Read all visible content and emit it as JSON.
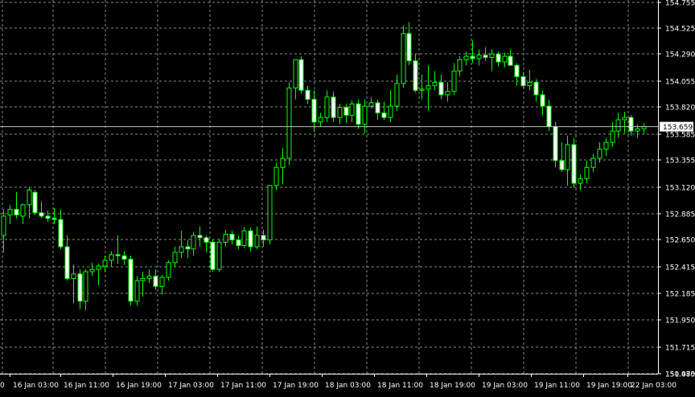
{
  "colors": {
    "background": "#000000",
    "grid": "#8a8a8a",
    "axis": "#ffffff",
    "bull_body": "#000000",
    "bull_outline": "#00ff00",
    "bear_body": "#ffffff",
    "bear_outline": "#00ff00",
    "bid_line": "#c0c0c0",
    "bid_label_bg": "#ffffff"
  },
  "chart_data": {
    "type": "candlestick",
    "grid": true,
    "ylim": [
      150.075,
      154.75
    ],
    "y_ticks": [
      "154.755",
      "154.525",
      "154.290",
      "154.055",
      "153.820",
      "153.585",
      "153.355",
      "153.120",
      "152.885",
      "152.650",
      "152.415",
      "152.185",
      "151.950",
      "151.715",
      "151.480",
      "150.075"
    ],
    "x_ticks": [
      "0",
      "16 Jan 03:00",
      "16 Jan 11:00",
      "16 Jan 19:00",
      "17 Jan 03:00",
      "17 Jan 11:00",
      "17 Jan 19:00",
      "18 Jan 03:00",
      "18 Jan 11:00",
      "18 Jan 19:00",
      "19 Jan 03:00",
      "19 Jan 11:00",
      "19 Jan 19:00",
      "22 Jan 03:00"
    ],
    "bid": "153.659",
    "ohlc": [
      [
        152.7,
        152.93,
        152.55,
        152.87
      ],
      [
        152.88,
        152.97,
        152.8,
        152.93
      ],
      [
        152.93,
        153.08,
        152.85,
        152.88
      ],
      [
        152.87,
        152.98,
        152.8,
        152.97
      ],
      [
        152.97,
        153.12,
        152.85,
        153.1
      ],
      [
        153.08,
        153.1,
        152.88,
        152.9
      ],
      [
        152.9,
        153.0,
        152.85,
        152.87
      ],
      [
        152.87,
        152.92,
        152.82,
        152.85
      ],
      [
        152.85,
        152.94,
        152.8,
        152.84
      ],
      [
        152.84,
        152.93,
        152.58,
        152.6
      ],
      [
        152.6,
        152.7,
        152.3,
        152.32
      ],
      [
        152.32,
        152.44,
        152.1,
        152.36
      ],
      [
        152.36,
        152.4,
        152.05,
        152.12
      ],
      [
        152.12,
        152.4,
        152.04,
        152.38
      ],
      [
        152.38,
        152.46,
        152.34,
        152.4
      ],
      [
        152.4,
        152.45,
        152.26,
        152.43
      ],
      [
        152.43,
        152.52,
        152.38,
        152.48
      ],
      [
        152.48,
        152.56,
        152.42,
        152.53
      ],
      [
        152.53,
        152.7,
        152.45,
        152.52
      ],
      [
        152.52,
        152.56,
        152.44,
        152.49
      ],
      [
        152.49,
        152.52,
        152.08,
        152.12
      ],
      [
        152.12,
        152.34,
        152.08,
        152.3
      ],
      [
        152.3,
        152.38,
        152.16,
        152.32
      ],
      [
        152.32,
        152.4,
        152.28,
        152.34
      ],
      [
        152.34,
        152.4,
        152.22,
        152.25
      ],
      [
        152.25,
        152.35,
        152.18,
        152.33
      ],
      [
        152.33,
        152.48,
        152.3,
        152.46
      ],
      [
        152.46,
        152.6,
        152.42,
        152.55
      ],
      [
        152.55,
        152.74,
        152.5,
        152.6
      ],
      [
        152.6,
        152.66,
        152.5,
        152.58
      ],
      [
        152.58,
        152.73,
        152.52,
        152.7
      ],
      [
        152.7,
        152.78,
        152.6,
        152.68
      ],
      [
        152.68,
        152.7,
        152.55,
        152.64
      ],
      [
        152.64,
        152.66,
        152.38,
        152.4
      ],
      [
        152.4,
        152.67,
        152.38,
        152.64
      ],
      [
        152.64,
        152.75,
        152.6,
        152.71
      ],
      [
        152.71,
        152.74,
        152.62,
        152.66
      ],
      [
        152.66,
        152.7,
        152.58,
        152.61
      ],
      [
        152.61,
        152.77,
        152.59,
        152.74
      ],
      [
        152.74,
        152.77,
        152.56,
        152.6
      ],
      [
        152.6,
        152.78,
        152.58,
        152.7
      ],
      [
        152.7,
        152.75,
        152.6,
        152.66
      ],
      [
        152.66,
        152.98,
        152.62,
        153.14
      ],
      [
        153.14,
        153.34,
        153.1,
        153.3
      ],
      [
        153.3,
        153.47,
        153.15,
        153.38
      ],
      [
        153.38,
        154.05,
        153.32,
        154.0
      ],
      [
        154.0,
        154.22,
        153.9,
        154.25
      ],
      [
        154.25,
        154.28,
        153.95,
        153.98
      ],
      [
        153.98,
        154.02,
        153.86,
        153.9
      ],
      [
        153.9,
        153.98,
        153.62,
        153.7
      ],
      [
        153.7,
        153.78,
        153.66,
        153.74
      ],
      [
        153.74,
        153.98,
        153.7,
        153.92
      ],
      [
        153.92,
        153.97,
        153.7,
        153.74
      ],
      [
        153.74,
        153.86,
        153.68,
        153.83
      ],
      [
        153.83,
        153.86,
        153.69,
        153.76
      ],
      [
        153.76,
        153.89,
        153.7,
        153.86
      ],
      [
        153.86,
        153.9,
        153.64,
        153.68
      ],
      [
        153.68,
        153.9,
        153.6,
        153.84
      ],
      [
        153.84,
        153.92,
        153.82,
        153.87
      ],
      [
        153.87,
        153.9,
        153.72,
        153.78
      ],
      [
        153.78,
        153.88,
        153.72,
        153.74
      ],
      [
        153.74,
        153.98,
        153.7,
        153.84
      ],
      [
        153.84,
        154.12,
        153.8,
        154.04
      ],
      [
        154.04,
        154.55,
        154.0,
        154.48
      ],
      [
        154.48,
        154.58,
        154.2,
        154.24
      ],
      [
        154.24,
        154.3,
        153.96,
        153.98
      ],
      [
        153.98,
        154.12,
        153.9,
        153.99
      ],
      [
        153.99,
        154.2,
        153.8,
        154.02
      ],
      [
        154.02,
        154.15,
        153.98,
        154.05
      ],
      [
        154.05,
        154.12,
        153.9,
        153.94
      ],
      [
        153.94,
        154.05,
        153.88,
        153.97
      ],
      [
        153.97,
        154.22,
        153.94,
        154.15
      ],
      [
        154.15,
        154.28,
        154.1,
        154.25
      ],
      [
        154.25,
        154.32,
        154.2,
        154.28
      ],
      [
        154.28,
        154.42,
        154.22,
        154.26
      ],
      [
        154.26,
        154.34,
        154.2,
        154.29
      ],
      [
        154.29,
        154.36,
        154.24,
        154.27
      ],
      [
        154.27,
        154.34,
        154.15,
        154.3
      ],
      [
        154.3,
        154.32,
        154.19,
        154.23
      ],
      [
        154.23,
        154.31,
        154.18,
        154.28
      ],
      [
        154.28,
        154.34,
        154.22,
        154.2
      ],
      [
        154.2,
        154.22,
        154.02,
        154.1
      ],
      [
        154.1,
        154.14,
        154.0,
        154.02
      ],
      [
        154.02,
        154.16,
        153.98,
        154.05
      ],
      [
        154.05,
        154.08,
        153.88,
        153.94
      ],
      [
        153.94,
        153.98,
        153.76,
        153.84
      ],
      [
        153.84,
        153.9,
        153.62,
        153.66
      ],
      [
        153.66,
        153.7,
        153.3,
        153.36
      ],
      [
        153.36,
        153.52,
        153.26,
        153.28
      ],
      [
        153.28,
        153.58,
        153.14,
        153.5
      ],
      [
        153.5,
        153.56,
        153.12,
        153.16
      ],
      [
        153.16,
        153.24,
        153.1,
        153.2
      ],
      [
        153.2,
        153.36,
        153.16,
        153.3
      ],
      [
        153.3,
        153.42,
        153.26,
        153.38
      ],
      [
        153.38,
        153.52,
        153.34,
        153.46
      ],
      [
        153.46,
        153.56,
        153.4,
        153.52
      ],
      [
        153.52,
        153.7,
        153.48,
        153.62
      ],
      [
        153.62,
        153.78,
        153.56,
        153.72
      ],
      [
        153.72,
        153.79,
        153.6,
        153.74
      ],
      [
        153.74,
        153.76,
        153.58,
        153.62
      ],
      [
        153.62,
        153.68,
        153.56,
        153.64
      ],
      [
        153.64,
        153.69,
        153.6,
        153.66
      ]
    ]
  }
}
